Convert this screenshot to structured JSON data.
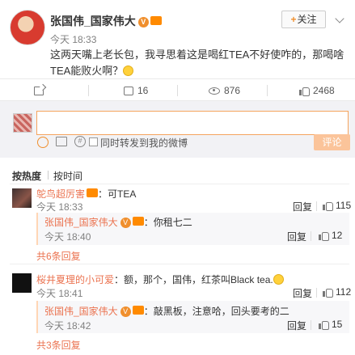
{
  "post": {
    "author": "张国伟_国家伟大",
    "v_badge": "V",
    "follow_label": "关注",
    "time": "今天 18:33",
    "text": "这两天嘴上老长包，我寻思着这是喝红TEA不好使咋的，那喝啥TEA能败火啊？"
  },
  "actions": {
    "comments": "16",
    "views": "876",
    "likes": "2468"
  },
  "composer": {
    "placeholder": "",
    "topic_icon": "#",
    "repost_label": "同时转发到我的微博",
    "submit_label": "评论"
  },
  "sort": {
    "hot": "按热度",
    "time": "按时间"
  },
  "comments": [
    {
      "name": "鸵鸟超厉害",
      "text": "：可TEA",
      "time": "今天 18:33",
      "reply_label": "回复",
      "likes": "115",
      "sub": {
        "name": "张国伟_国家伟大",
        "text": "：你租七二",
        "time": "今天 18:40",
        "reply_label": "回复",
        "likes": "12"
      },
      "more": "共6条回复"
    },
    {
      "name": "桜井夏理的小可爱",
      "text": "：额，那个，国伟，红茶叫Black tea.",
      "time": "今天 18:41",
      "reply_label": "回复",
      "likes": "112",
      "sub": {
        "name": "张国伟_国家伟大",
        "text": "：敲黑板，注意哈，回头要考的二",
        "time": "今天 18:42",
        "reply_label": "回复",
        "likes": "15"
      },
      "more": "共3条回复"
    }
  ],
  "colors": {
    "accent": "#eb7350",
    "orange": "#f08f2d",
    "composer_bg": "#f2f2f5"
  }
}
